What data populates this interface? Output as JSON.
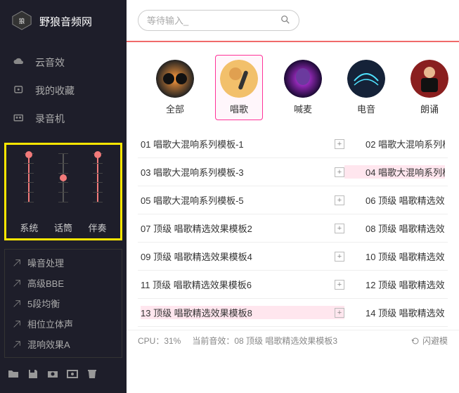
{
  "app": {
    "title": "野狼音频网"
  },
  "search": {
    "placeholder": "等待输入_"
  },
  "nav": [
    {
      "label": "云音效",
      "icon": "cloud-icon"
    },
    {
      "label": "我的收藏",
      "icon": "bookmark-icon"
    },
    {
      "label": "录音机",
      "icon": "recorder-icon"
    }
  ],
  "sliders": {
    "labels": [
      "系统",
      "话筒",
      "伴奏"
    ],
    "values": [
      100,
      55,
      100
    ]
  },
  "fx": [
    {
      "label": "噪音处理"
    },
    {
      "label": "高级BBE"
    },
    {
      "label": "5段均衡"
    },
    {
      "label": "相位立体声"
    },
    {
      "label": "混响效果A"
    }
  ],
  "bottom_icons": [
    "folder-icon",
    "save-icon",
    "camera-icon",
    "capture-icon",
    "trash-icon"
  ],
  "categories": [
    {
      "label": "全部"
    },
    {
      "label": "唱歌",
      "selected": true
    },
    {
      "label": "喊麦"
    },
    {
      "label": "电音"
    },
    {
      "label": "朗诵"
    }
  ],
  "list": [
    {
      "l": "01 唱歌大混响系列模板-1",
      "r": "02 唱歌大混响系列模"
    },
    {
      "l": "03 唱歌大混响系列模板-3",
      "r": "04 唱歌大混响系列模",
      "r_hl": true
    },
    {
      "l": "05 唱歌大混响系列模板-5",
      "r": "06 顶级 唱歌精选效果"
    },
    {
      "l": "07 顶级 唱歌精选效果模板2",
      "r": "08 顶级 唱歌精选效果"
    },
    {
      "l": "09 顶级 唱歌精选效果模板4",
      "r": "10 顶级 唱歌精选效果"
    },
    {
      "l": "11 顶级 唱歌精选效果模板6",
      "r": "12 顶级 唱歌精选效果"
    },
    {
      "l": "13 顶级 唱歌精选效果模板8",
      "r": "14 顶级 唱歌精选效果",
      "l_hl": true
    }
  ],
  "status": {
    "cpu": "CPU：31%",
    "current": "当前音效：08 顶级 唱歌精选效果模板3",
    "dodge": "闪避模"
  }
}
